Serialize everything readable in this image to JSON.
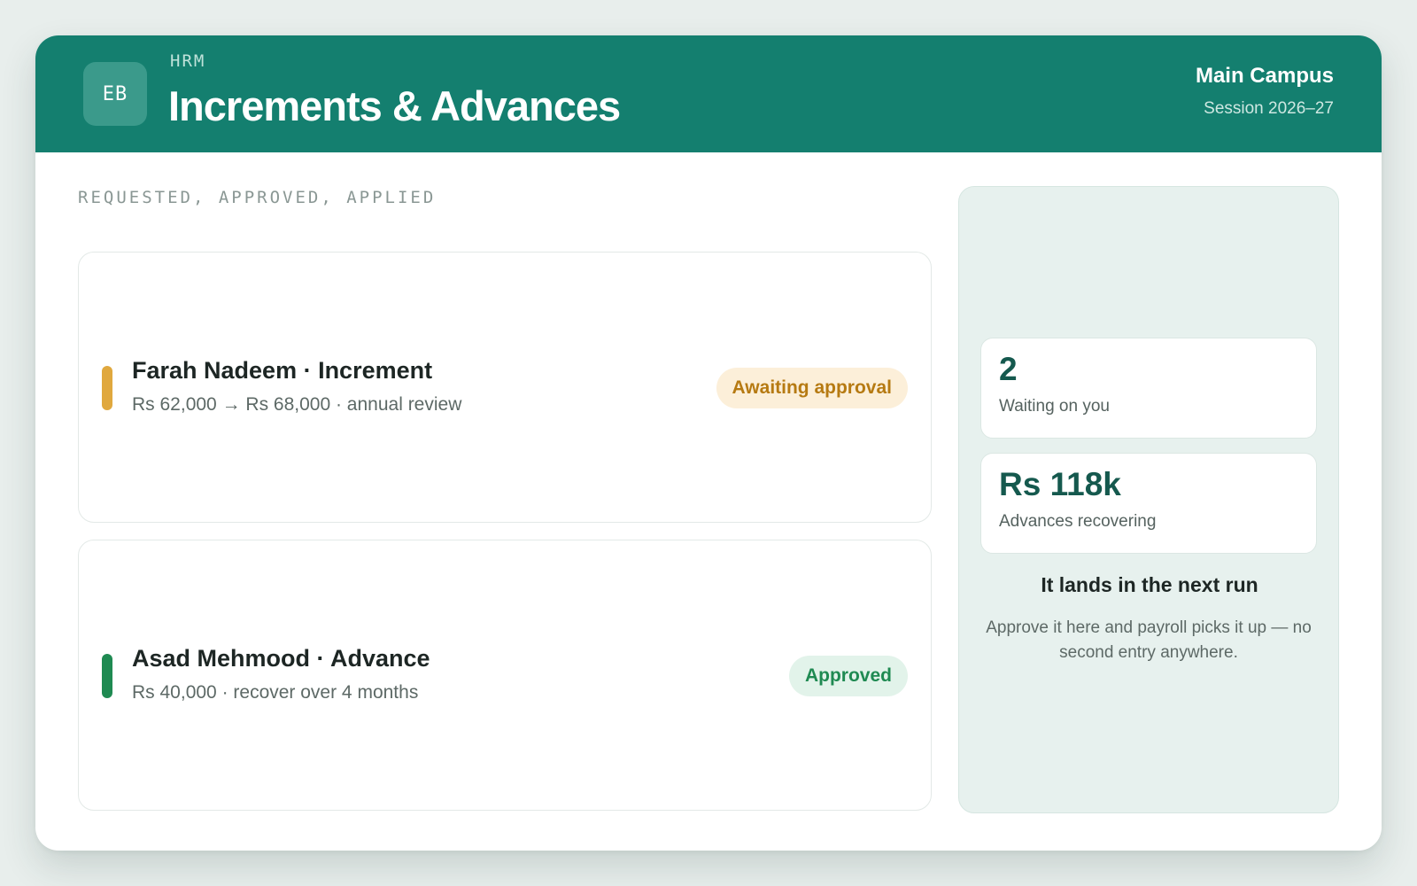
{
  "header": {
    "logo_initials": "EB",
    "app_label": "HRM",
    "title": "Increments & Advances",
    "campus": "Main Campus",
    "session": "Session 2026–27"
  },
  "section_label": "REQUESTED, APPROVED, APPLIED",
  "requests": [
    {
      "title": "Farah Nadeem · Increment",
      "detail": "Rs 62,000 → Rs 68,000 · annual review",
      "status": "Awaiting approval",
      "status_color": "#e0a83e"
    },
    {
      "title": "Asad Mehmood · Advance",
      "detail": "Rs 40,000 · recover over 4 months",
      "status": "Approved",
      "status_color": "#1f8a52"
    }
  ],
  "summary": {
    "stats": [
      {
        "value": "2",
        "label": "Waiting on you"
      },
      {
        "value": "Rs 118k",
        "label": "Advances recovering"
      }
    ],
    "note_title": "It lands in the next run",
    "note_body": "Approve it here and payroll picks it up — no second entry anywhere."
  },
  "colors": {
    "header": "#147f6f",
    "accent_dark": "#15594e",
    "pending": "#e0a83e",
    "approved": "#1f8a52"
  }
}
